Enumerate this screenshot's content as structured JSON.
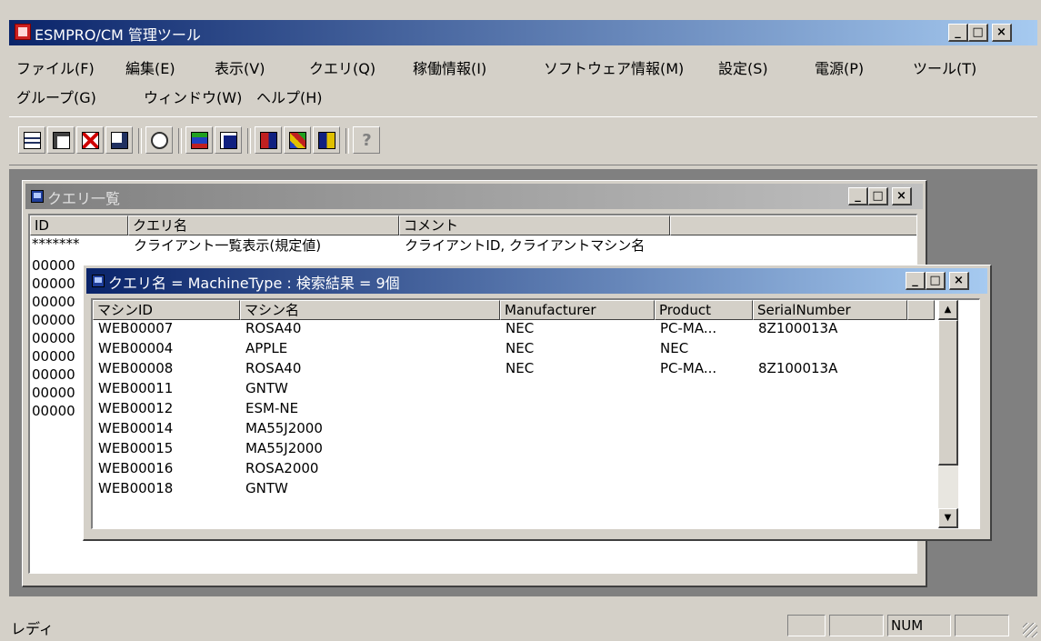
{
  "app": {
    "title": "ESMPRO/CM 管理ツール"
  },
  "menu": [
    "ファイル(F)",
    "編集(E)",
    "表示(V)",
    "クエリ(Q)",
    "稼働情報(I)",
    "ソフトウェア情報(M)",
    "設定(S)",
    "電源(P)",
    "ツール(T)",
    "グループ(G)",
    "ウィンドウ(W)",
    "ヘルプ(H)"
  ],
  "toolbar_icons": [
    "client-list-icon",
    "client-properties-icon",
    "delete-icon",
    "search-icon",
    "signature-icon",
    "monitor-report-icon",
    "monitor-icon",
    "query-result-icon",
    "network-icon",
    "schedule-icon",
    "help-icon"
  ],
  "query_list": {
    "title": "クエリ一覧",
    "columns": [
      "ID",
      "クエリ名",
      "コメント",
      ""
    ],
    "rows": [
      [
        "*******",
        "クライアント一覧表示(規定値)",
        "クライアントID, クライアントマシン名"
      ],
      [
        "00000",
        "",
        ""
      ],
      [
        "00000",
        "",
        ""
      ],
      [
        "00000",
        "",
        ""
      ],
      [
        "00000",
        "",
        ""
      ],
      [
        "00000",
        "",
        ""
      ],
      [
        "00000",
        "",
        ""
      ],
      [
        "00000",
        "",
        ""
      ],
      [
        "00000",
        "",
        ""
      ],
      [
        "00000",
        "",
        ""
      ]
    ]
  },
  "result": {
    "title": "クエリ名 = MachineType : 検索結果 = 9個",
    "columns": [
      "マシンID",
      "マシン名",
      "Manufacturer",
      "Product",
      "SerialNumber"
    ],
    "rows": [
      [
        "WEB00007",
        "ROSA40",
        "NEC",
        "PC-MA...",
        "8Z100013A"
      ],
      [
        "WEB00004",
        "APPLE",
        "NEC",
        "NEC",
        ""
      ],
      [
        "WEB00008",
        "ROSA40",
        "NEC",
        "PC-MA...",
        "8Z100013A"
      ],
      [
        "WEB00011",
        "GNTW",
        "",
        "",
        ""
      ],
      [
        "WEB00012",
        "ESM-NE",
        "",
        "",
        ""
      ],
      [
        "WEB00014",
        "MA55J2000",
        "",
        "",
        ""
      ],
      [
        "WEB00015",
        "MA55J2000",
        "",
        "",
        ""
      ],
      [
        "WEB00016",
        "ROSA2000",
        "",
        "",
        ""
      ],
      [
        "WEB00018",
        "GNTW",
        "",
        "",
        ""
      ]
    ],
    "scroll_up": "▲",
    "scroll_down": "▼"
  },
  "status": {
    "text": "レディ",
    "panels": [
      "",
      "",
      "NUM",
      ""
    ]
  },
  "window_buttons": {
    "minimize": "_",
    "maximize": "□",
    "close": "×"
  }
}
